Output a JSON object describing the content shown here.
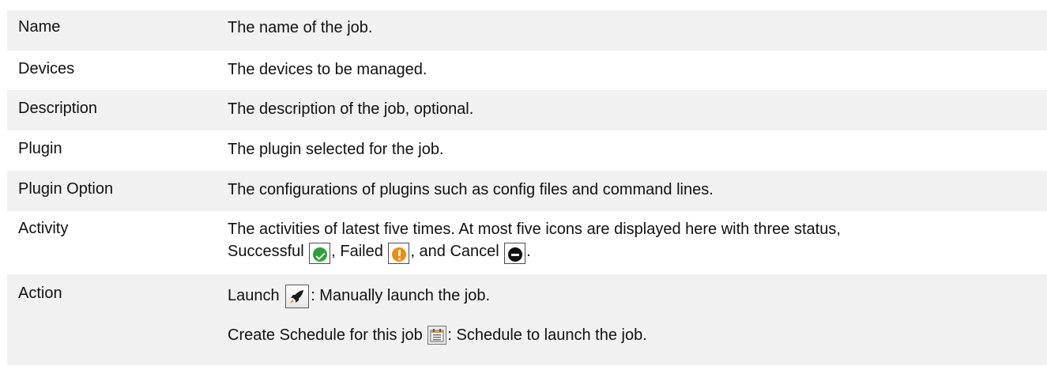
{
  "rows": [
    {
      "term": "Name",
      "definition": "The name of the job."
    },
    {
      "term": "Devices",
      "definition": "The devices to be managed."
    },
    {
      "term": "Description",
      "definition": "The description of the job, optional."
    },
    {
      "term": "Plugin",
      "definition": "The plugin selected for the job."
    },
    {
      "term": "Plugin Option",
      "definition": "The configurations of plugins such as config files and command lines."
    },
    {
      "term": "Activity",
      "definition_line1": "The activities of latest five times. At most five icons are displayed here with three status,",
      "successful": "Successful",
      "failed": ", Failed",
      "cancel": ", and Cancel",
      "end": "."
    },
    {
      "term": "Action",
      "launch": "Launch",
      "launch_desc": ": Manually launch the job.",
      "schedule": "Create Schedule for this job",
      "schedule_desc": ": Schedule to launch the job."
    }
  ],
  "icons": {
    "successful": "check-circle-icon",
    "failed": "warning-circle-icon",
    "cancel": "minus-circle-icon",
    "launch": "rocket-icon",
    "schedule": "calendar-icon"
  },
  "colors": {
    "shaded_row": "#f1f1f1",
    "success": "#2f9e3a",
    "failed": "#f08b17",
    "cancel": "#111111"
  }
}
